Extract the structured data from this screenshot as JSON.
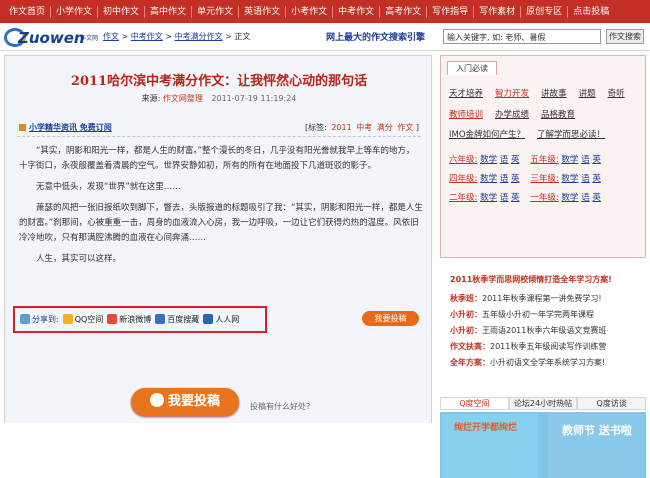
{
  "nav": [
    "作文首页",
    "小学作文",
    "初中作文",
    "高中作文",
    "单元作文",
    "英语作文",
    "小考作文",
    "中考作文",
    "高考作文",
    "写作指导",
    "写作素材",
    "原创专区",
    "点击投稿"
  ],
  "logo": {
    "text": "Zuowen",
    "sub": "作文网"
  },
  "breadcrumb": [
    "作文",
    "中考作文",
    "中考满分作文",
    "正文"
  ],
  "slogan": "网上最大的作文搜索引擎",
  "search": {
    "value": "输入关键字, 如: 老师、暑假",
    "button": "作文搜索"
  },
  "article": {
    "title": "2011哈尔滨中考满分作文：让我怦然心动的那句话",
    "source_label": "来源:",
    "source": "作文网整理",
    "date": "2011-07-19 11:19:24",
    "promo": "小学精华资讯 免费订阅",
    "tags_label": "[标签:",
    "tags": [
      "2011",
      "中考",
      "满分",
      "作文"
    ],
    "tags_end": "]",
    "paragraphs": [
      "“其实，阴影和阳光一样，都是人生的财富。”整个漫长的冬日，几乎没有阳光誊就我早上等车的地方，十字街口，永夜般覆盖着清晨的空气。世界安静如初，所有的所有在地面投下几道斑驳的影子。",
      "无意中低头，发现“世界”就在这里……",
      "萧瑟的风把一张旧报纸吹到脚下，瞥去，头版报道的标题吸引了我：“其实，阴影和阳光一样，都是人生的财富。”刹那间，心被重重一击，周身的血液流入心房，我一边呼吸，一边让它们获得灼热的温度。风依旧冷冷地吹，只有那满腔沸腾的血液在心间奔涌……",
      "人生，其实可以这样。"
    ],
    "share_label": "分享到:",
    "share_items": [
      "QQ空间",
      "新浪微博",
      "百度搜藏",
      "人人网"
    ],
    "submit_small": "我要投稿",
    "submit_big": "我要投稿",
    "question": "投稿有什么好处?"
  },
  "sidebar": {
    "tab": "入门必读",
    "rows": [
      [
        "天才培养",
        "智力开发",
        "讲故事",
        "讲题",
        "奇听"
      ],
      [
        "教师培训",
        "办学成绩",
        "品格教育"
      ],
      [
        "IMO金牌如何产生？",
        "了解学而思必读！"
      ]
    ],
    "grades": [
      {
        "left": "六年级:",
        "ls": [
          "数学",
          "语",
          "英"
        ],
        "right": "五年级:",
        "rs": [
          "数学",
          "语",
          "英"
        ]
      },
      {
        "left": "四年级:",
        "ls": [
          "数学",
          "语",
          "英"
        ],
        "right": "三年级:",
        "rs": [
          "数学",
          "语",
          "英"
        ]
      },
      {
        "left": "二年级:",
        "ls": [
          "数学",
          "语",
          "英"
        ],
        "right": "一年级:",
        "rs": [
          "数学",
          "语",
          "英"
        ]
      }
    ],
    "promo_head": "2011秋季学而思网校倾情打造全年学习方案!",
    "promo_items": [
      {
        "k": "秋季班：",
        "v": "2011年秋季课程第一讲免费学习!"
      },
      {
        "k": "小升初：",
        "v": "五年级小升初一年学完两年课程"
      },
      {
        "k": "小升初：",
        "v": "王雨语2011秋季六年级语文竞赛班"
      },
      {
        "k": "作文扶高：",
        "v": "2011秋季五年级阅读写作训练营"
      },
      {
        "k": "全年方案：",
        "v": "小升初语文全学年系统学习方案!"
      }
    ],
    "tabs": [
      "Q度空间",
      "论坛24小时热帖",
      "Q度访谈"
    ],
    "images": [
      "绚烂开学都绚烂",
      "教师节 送书啦"
    ]
  }
}
